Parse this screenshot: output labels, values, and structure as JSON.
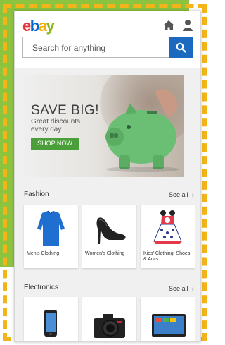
{
  "brand": {
    "logo_letters": [
      "e",
      "b",
      "a",
      "y"
    ],
    "logo_colors": [
      "#e53238",
      "#0064d2",
      "#f5af02",
      "#86b817"
    ]
  },
  "header": {
    "icons": [
      "home-icon",
      "user-icon"
    ],
    "search": {
      "placeholder": "Search for anything",
      "button_icon": "search-icon"
    }
  },
  "banner": {
    "title": "SAVE BIG!",
    "subtitle": "Great discounts every day",
    "button_label": "SHOP NOW"
  },
  "sections": [
    {
      "title": "Fashion",
      "see_all": "See all",
      "items": [
        {
          "label": "Men's Clothing"
        },
        {
          "label": "Women's Clothing"
        },
        {
          "label": "Kids' Clothing, Shoes & Accs."
        }
      ]
    },
    {
      "title": "Electronics",
      "see_all": "See all",
      "items": [
        {
          "label": ""
        },
        {
          "label": ""
        },
        {
          "label": ""
        }
      ]
    }
  ],
  "colors": {
    "accent_blue": "#1c6ac0",
    "banner_button": "#4a9f3a",
    "frame_dash": "#f2b418",
    "background_green": "#8cc43f"
  }
}
